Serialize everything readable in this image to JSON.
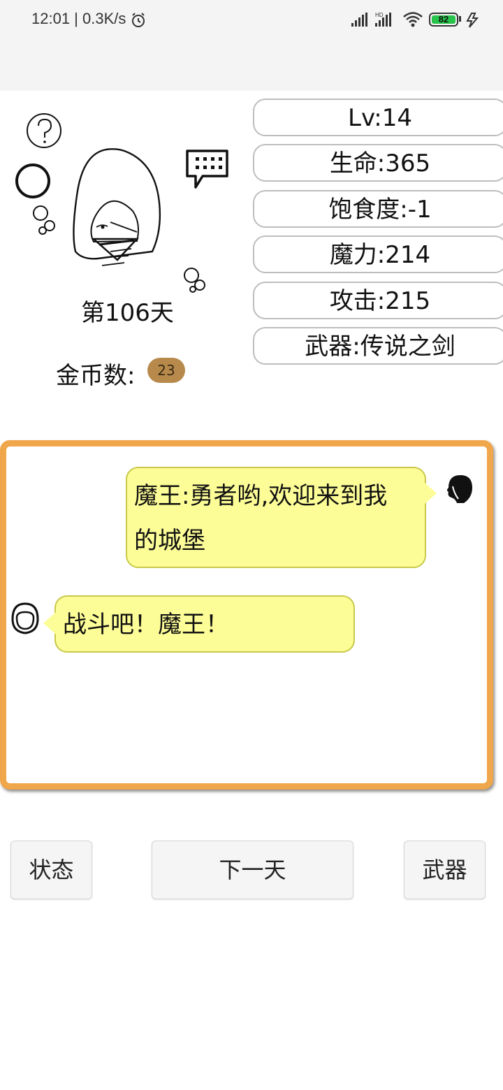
{
  "status_bar": {
    "time": "12:01 | 0.3K/s",
    "battery": "82"
  },
  "player": {
    "day": "第106天",
    "gold_label": "金币数:",
    "gold_value": "23"
  },
  "stats": [
    {
      "text": "Lv:14"
    },
    {
      "text": "生命:365"
    },
    {
      "text": "饱食度:-1"
    },
    {
      "text": "魔力:214"
    },
    {
      "text": "攻击:215"
    },
    {
      "text": "武器:传说之剑"
    }
  ],
  "chat": {
    "boss_line_1": "魔王:勇者哟,欢迎来到我",
    "boss_line_2": "的城堡",
    "hero_line": "战斗吧！魔王！"
  },
  "buttons": {
    "status": "状态",
    "next_day": "下一天",
    "weapon": "武器"
  },
  "colors": {
    "chat_border": "#f0a64a",
    "bubble": "#fdfd98",
    "gold_badge": "#b78a4c",
    "battery_fill": "#27c34a"
  },
  "icons": [
    "alarm-icon",
    "signal-icon",
    "wifi-icon",
    "battery-icon",
    "charging-icon",
    "question-icon",
    "chat-icon",
    "boss-avatar-icon",
    "hero-avatar-icon"
  ]
}
